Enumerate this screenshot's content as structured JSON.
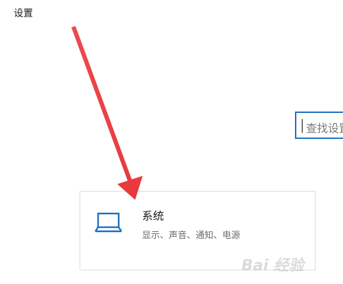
{
  "window": {
    "title": "设置"
  },
  "search": {
    "placeholder": "查找设置"
  },
  "tiles": [
    {
      "title": "系统",
      "subtitle": "显示、声音、通知、电源",
      "icon": "laptop-icon"
    }
  ],
  "annotation": {
    "arrow_color": "#e8383d"
  },
  "watermark": {
    "text": "Bai 经验"
  },
  "colors": {
    "accent": "#1e6fbf",
    "border": "#dcdcdc"
  }
}
